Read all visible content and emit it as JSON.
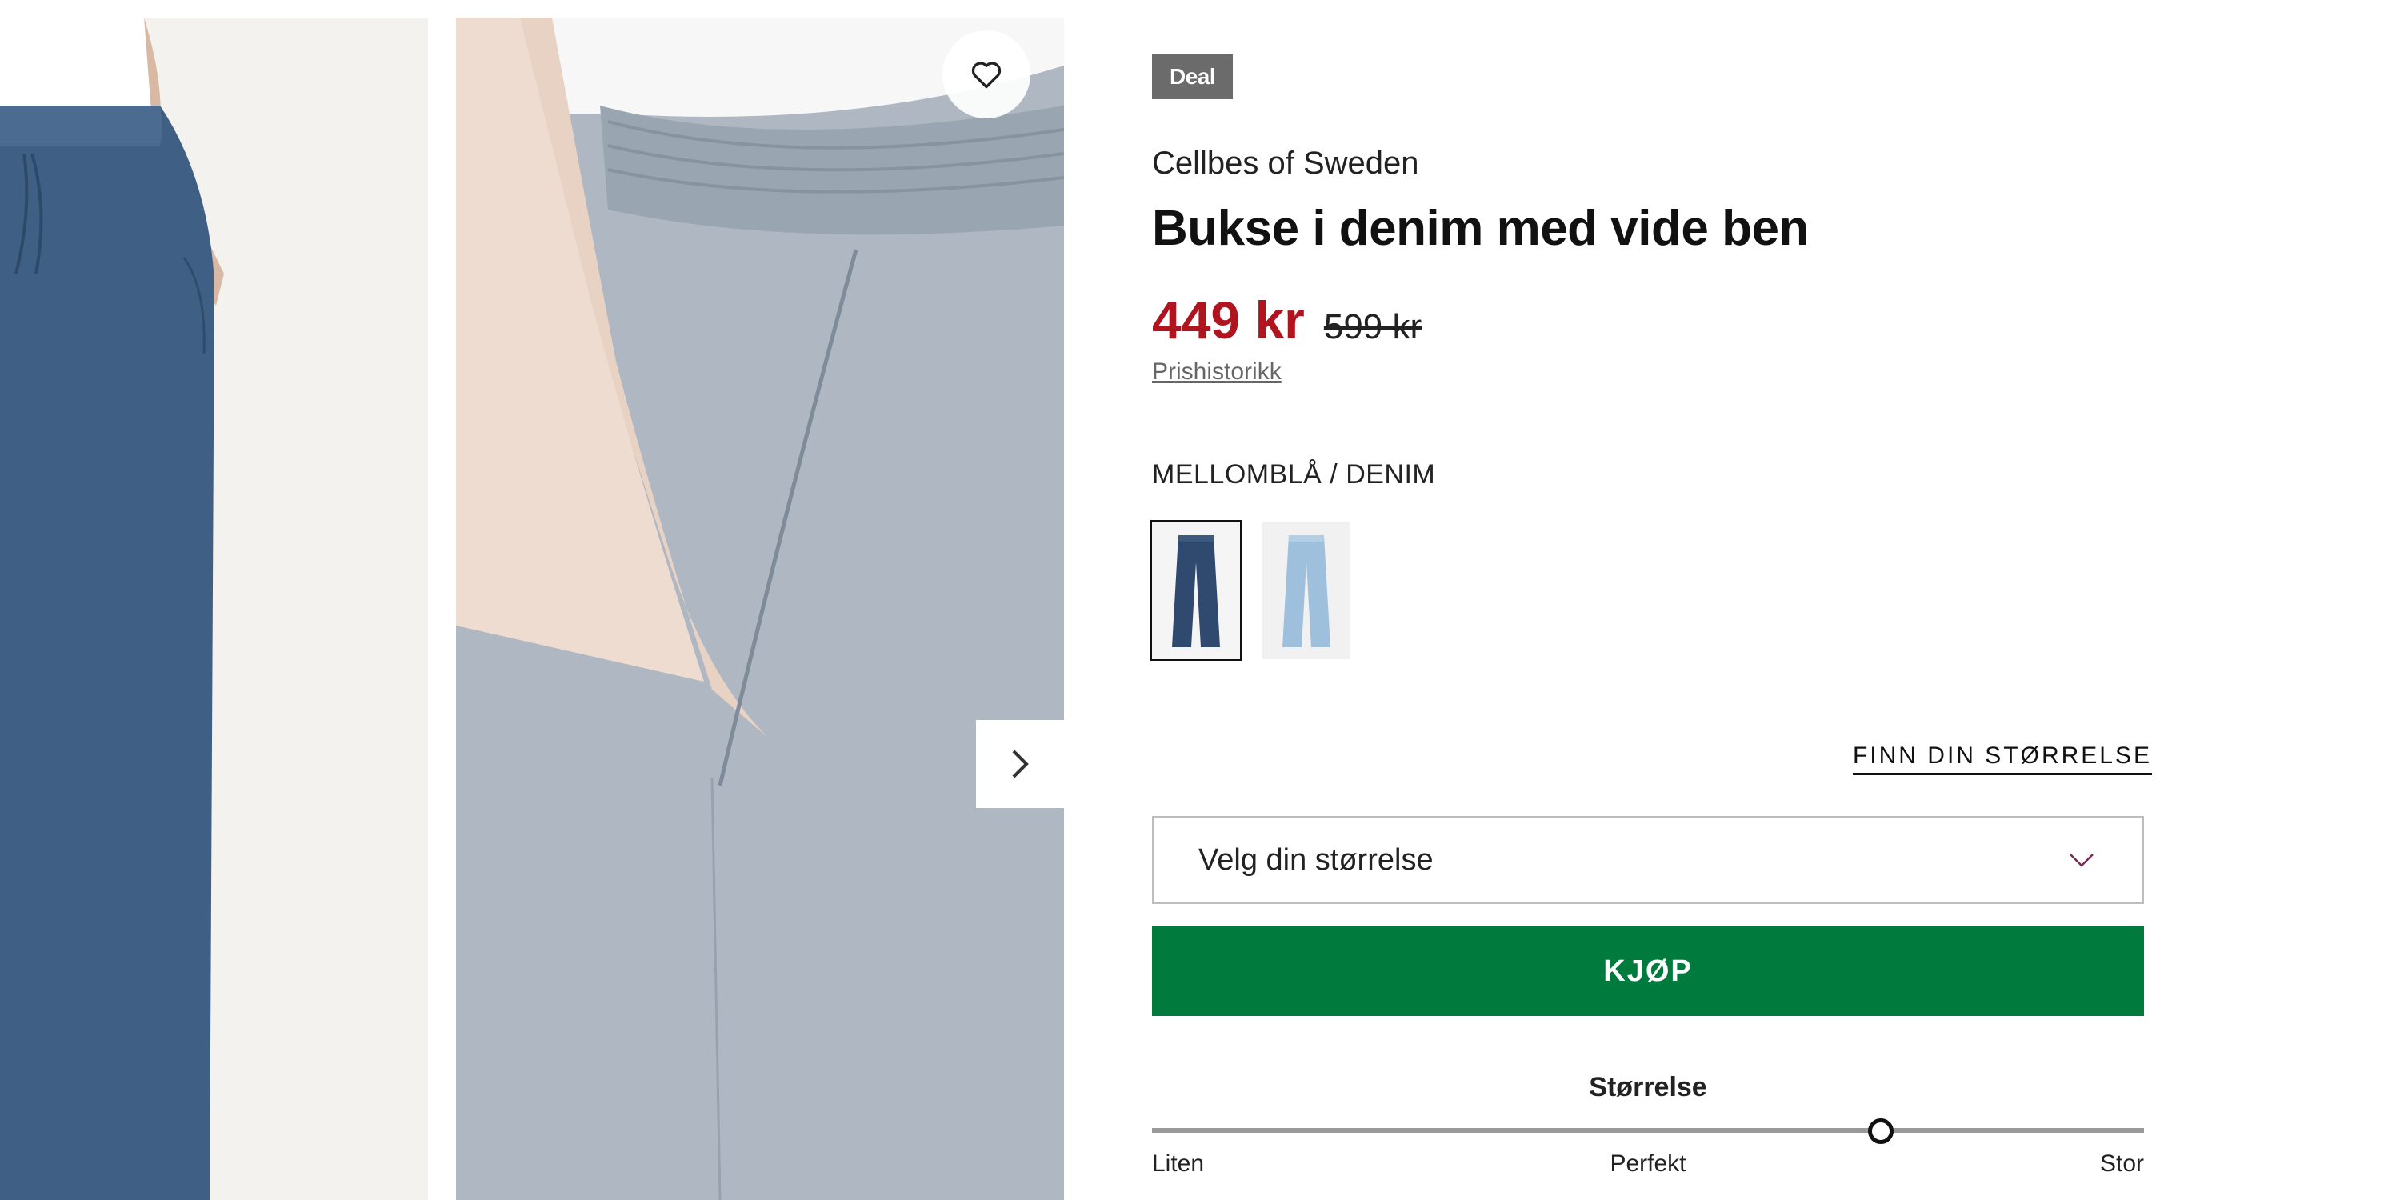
{
  "product": {
    "badge": "Deal",
    "brand": "Cellbes of Sweden",
    "title": "Bukse i denim med vide ben",
    "price_now": "449 kr",
    "price_old": "599 kr",
    "price_history_link": "Prishistorikk",
    "color_label": "MELLOMBLÅ / DENIM",
    "swatches": [
      {
        "name": "mellomblå denim",
        "color": "#2f4a6e",
        "selected": true
      },
      {
        "name": "lys denim",
        "color": "#9fc0dc",
        "selected": false
      }
    ]
  },
  "size": {
    "find_size_link": "FINN DIN STØRRELSE",
    "select_placeholder": "Velg din størrelse"
  },
  "buy_button": "KJØP",
  "fit": {
    "title": "Størrelse",
    "label_left": "Liten",
    "label_mid": "Perfekt",
    "label_right": "Stor",
    "value": 0.735
  },
  "icons": {
    "favorite": "heart-icon",
    "next": "chevron-right-icon",
    "dropdown": "chevron-down-icon"
  },
  "colors": {
    "price": "#b0151f",
    "buy": "#007a3d",
    "badge": "#6b6b6b",
    "chevron": "#7a2a5a"
  }
}
